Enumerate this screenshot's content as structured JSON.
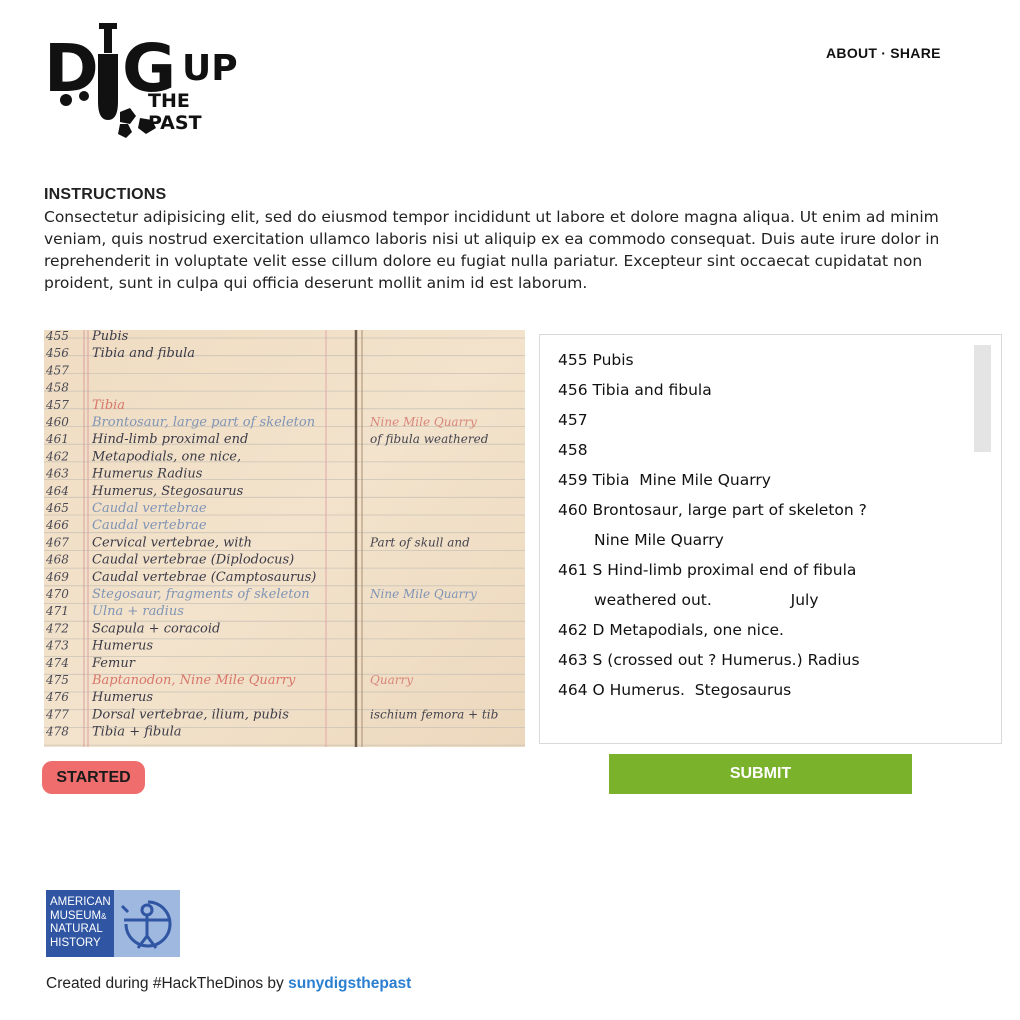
{
  "logo": {
    "word1_d": "D",
    "word1_g": "G",
    "word2": "UP",
    "tagline": "THE PAST"
  },
  "nav": {
    "about": "ABOUT",
    "separator": "·",
    "share": "SHARE"
  },
  "instructions": {
    "heading": "INSTRUCTIONS",
    "body": "Consectetur adipisicing elit, sed do eiusmod tempor incididunt ut labore et dolore magna aliqua. Ut enim ad minim veniam, quis nostrud exercitation ullamco laboris nisi ut aliquip ex ea commodo consequat. Duis aute irure dolor in reprehenderit in voluptate velit esse cillum dolore eu fugiat nulla pariatur. Excepteur sint occaecat cupidatat non proident, sunt in culpa qui officia deserunt mollit anim id est laborum."
  },
  "ledger": {
    "numbers": [
      "455",
      "456",
      "457",
      "458",
      "457",
      "460",
      "461",
      "462",
      "463",
      "464",
      "465",
      "466",
      "467",
      "468",
      "469",
      "470",
      "471",
      "472",
      "473",
      "474",
      "475",
      "476",
      "477",
      "478"
    ],
    "entries": [
      "Pubis",
      "Tibia and fibula",
      "",
      "",
      "Tibia",
      "Brontosaur, large part of skeleton",
      "Hind-limb proximal end",
      "Metapodials, one nice,",
      "Humerus  Radius",
      "Humerus, Stegosaurus",
      "Caudal vertebrae",
      "Caudal vertebrae",
      "Cervical vertebrae, with",
      "Caudal vertebrae (Diplodocus)",
      "Caudal vertebrae (Camptosaurus)",
      "Stegosaur, fragments of skeleton",
      "Ulna + radius",
      "Scapula + coracoid",
      "Humerus",
      "Femur",
      "Baptanodon, Nine Mile Quarry",
      "Humerus",
      "Dorsal vertebrae, ilium, pubis",
      "Tibia + fibula"
    ],
    "right_notes": [
      "Nine Mile Quarry",
      "of fibula weathered",
      "Part of skull and",
      "Nine Mile Quarry",
      "Quarry",
      "ischium femora + tib"
    ]
  },
  "transcript": {
    "lines": [
      {
        "text": "455 Pubis",
        "indent": false
      },
      {
        "text": "456 Tibia and fibula",
        "indent": false
      },
      {
        "text": "457",
        "indent": false
      },
      {
        "text": "458",
        "indent": false
      },
      {
        "text": "459 Tibia  Mine Mile Quarry",
        "indent": false
      },
      {
        "text": "460 Brontosaur, large part of skeleton ?",
        "indent": false
      },
      {
        "text": "Nine Mile Quarry",
        "indent": true
      },
      {
        "text": "461 S Hind-limb proximal end of fibula",
        "indent": false
      },
      {
        "text": "weathered out.                July",
        "indent": true
      },
      {
        "text": "462 D Metapodials, one nice.",
        "indent": false
      },
      {
        "text": "463 S (crossed out ? Humerus.) Radius",
        "indent": false
      },
      {
        "text": "464 O Humerus.  Stegosaurus",
        "indent": false
      }
    ]
  },
  "status": {
    "label": "STARTED",
    "color": "#ef6d6d"
  },
  "submit": {
    "label": "SUBMIT",
    "color": "#7ab22c"
  },
  "footer": {
    "museum_lines": [
      "AMERICAN",
      "MUSEUM",
      "NATURAL",
      "HISTORY"
    ],
    "museum_amp": "&",
    "credit_prefix": "Created during #HackTheDinos by ",
    "credit_link": "sunydigsthepast"
  }
}
